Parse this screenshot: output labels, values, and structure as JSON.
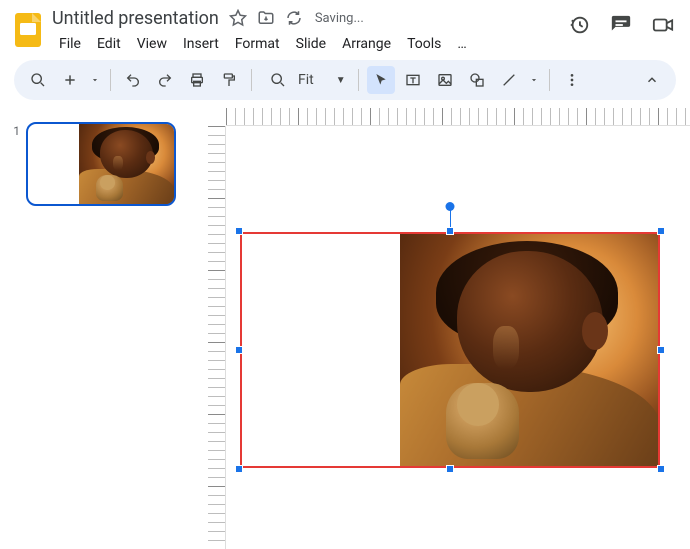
{
  "header": {
    "doc_title": "Untitled presentation",
    "saving_text": "Saving...",
    "menus": [
      "File",
      "Edit",
      "View",
      "Insert",
      "Format",
      "Slide",
      "Arrange",
      "Tools"
    ],
    "overflow": "…"
  },
  "toolbar": {
    "zoom_label": "Fit"
  },
  "thumbnails": {
    "slide_number": "1"
  },
  "selection": {
    "border_color": "#e53935",
    "handle_color": "#1a73e8"
  },
  "image": {
    "description": "Side profile of a child in warm golden light holding a small tan animal, subject occupies right side of frame, left side is white"
  }
}
